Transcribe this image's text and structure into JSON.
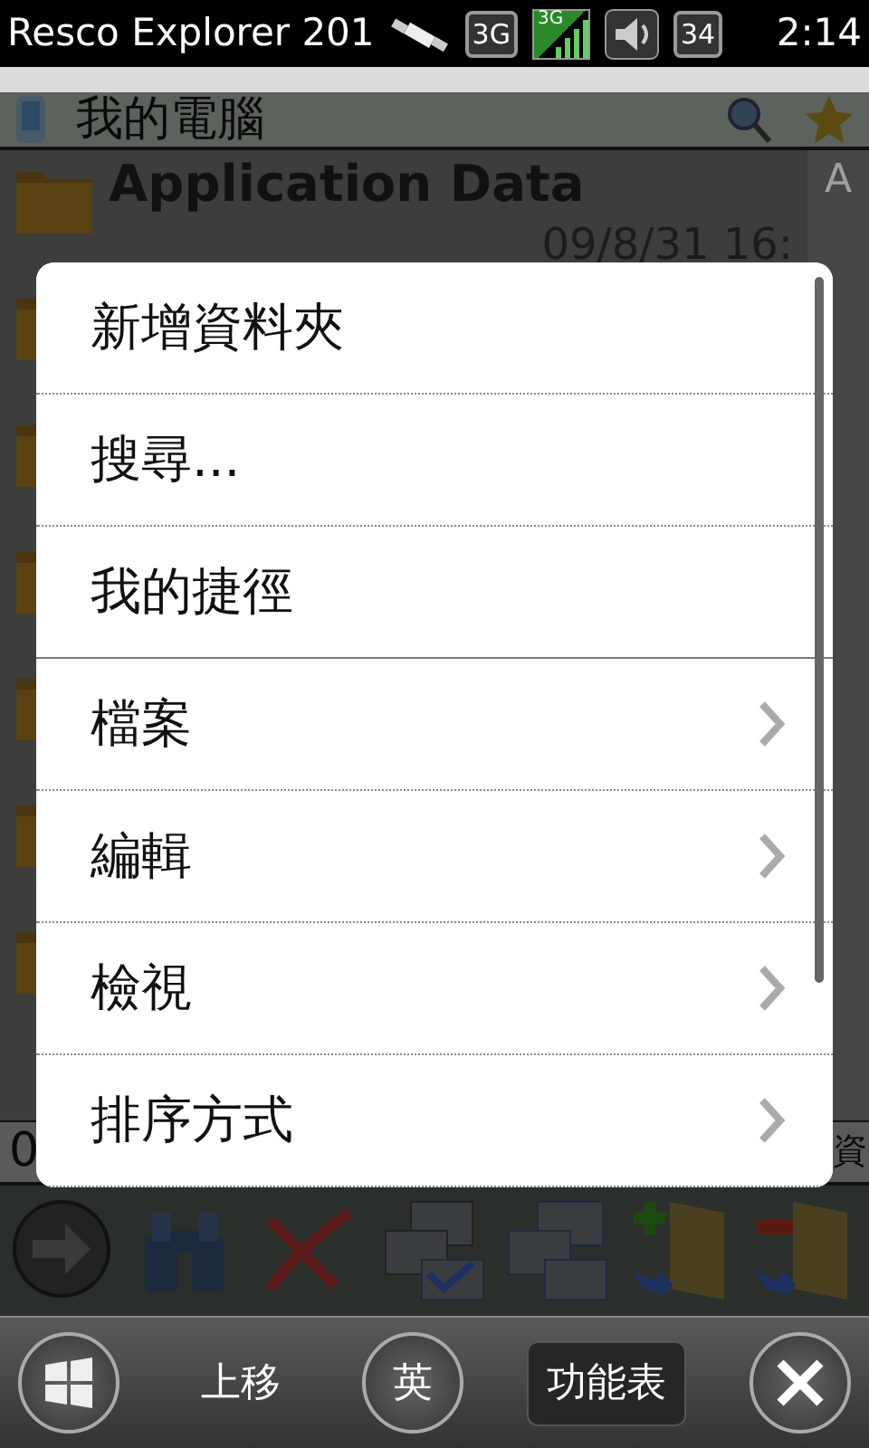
{
  "status_bar": {
    "title": "Resco Explorer 201",
    "network": "3G",
    "signal_label": "3G",
    "battery": "34",
    "time": "2:14"
  },
  "header": {
    "title": "我的電腦"
  },
  "file_list": {
    "index_letter": "A",
    "rows": [
      {
        "name": "Application Data",
        "date": "09/8/31 16:"
      }
    ],
    "bottom_row": {
      "column_1": "0",
      "column_2": "資"
    }
  },
  "menu": {
    "items": [
      {
        "label": "新增資料夾",
        "kind": "action",
        "group_end": false
      },
      {
        "label": "搜尋...",
        "kind": "action",
        "group_end": false
      },
      {
        "label": "我的捷徑",
        "kind": "action",
        "group_end": true
      },
      {
        "label": "檔案",
        "kind": "submenu",
        "group_end": false
      },
      {
        "label": "編輯",
        "kind": "submenu",
        "group_end": false
      },
      {
        "label": "檢視",
        "kind": "submenu",
        "group_end": false
      },
      {
        "label": "排序方式",
        "kind": "submenu",
        "group_end": false
      }
    ]
  },
  "taskbar": {
    "items": [
      {
        "kind": "start",
        "selected": false
      },
      {
        "kind": "text",
        "label": "上移",
        "selected": false
      },
      {
        "kind": "circle",
        "label": "英",
        "selected": false
      },
      {
        "kind": "text",
        "label": "功能表",
        "selected": true
      },
      {
        "kind": "close",
        "selected": false
      }
    ]
  }
}
